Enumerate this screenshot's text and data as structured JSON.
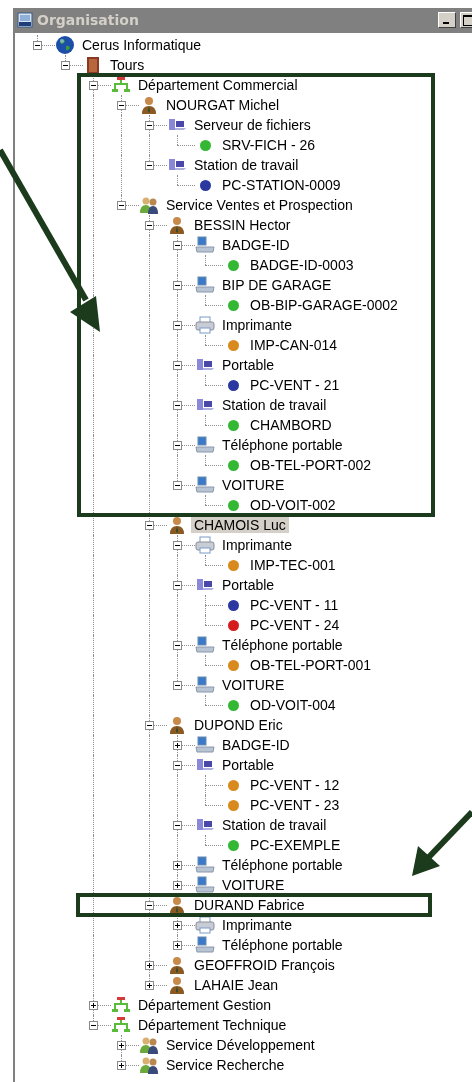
{
  "window": {
    "title": "Organisation"
  },
  "tree": [
    {
      "label": "Cerus Informatique",
      "kind": "organisation",
      "expanded": true,
      "selected": false,
      "children": [
        {
          "label": "Tours",
          "kind": "site",
          "expanded": true,
          "selected": false,
          "children": [
            {
              "label": "Département Commercial",
              "kind": "department",
              "expanded": true,
              "selected": false,
              "children": [
                {
                  "label": "NOURGAT Michel",
                  "kind": "person",
                  "expanded": true,
                  "selected": false,
                  "children": [
                    {
                      "label": "Serveur de fichiers",
                      "kind": "computer",
                      "expanded": true,
                      "selected": false,
                      "children": [
                        {
                          "label": "SRV-FICH - 26",
                          "kind": "device",
                          "color": "#34b834",
                          "selected": false
                        }
                      ]
                    },
                    {
                      "label": "Station de travail",
                      "kind": "computer",
                      "expanded": true,
                      "selected": false,
                      "children": [
                        {
                          "label": "PC-STATION-0009",
                          "kind": "device",
                          "color": "#2a38a0",
                          "selected": false
                        }
                      ]
                    }
                  ]
                },
                {
                  "label": "Service Ventes et Prospection",
                  "kind": "service",
                  "expanded": true,
                  "selected": false,
                  "children": [
                    {
                      "label": "BESSIN Hector",
                      "kind": "person",
                      "expanded": true,
                      "selected": false,
                      "children": [
                        {
                          "label": "BADGE-ID",
                          "kind": "workstation",
                          "expanded": true,
                          "selected": false,
                          "children": [
                            {
                              "label": "BADGE-ID-0003",
                              "kind": "device",
                              "color": "#34b834",
                              "selected": false
                            }
                          ]
                        },
                        {
                          "label": "BIP DE GARAGE",
                          "kind": "workstation",
                          "expanded": true,
                          "selected": false,
                          "children": [
                            {
                              "label": "OB-BIP-GARAGE-0002",
                              "kind": "device",
                              "color": "#34b834",
                              "selected": false
                            }
                          ]
                        },
                        {
                          "label": "Imprimante",
                          "kind": "printer",
                          "expanded": true,
                          "selected": false,
                          "children": [
                            {
                              "label": "IMP-CAN-014",
                              "kind": "device",
                              "color": "#d98a1c",
                              "selected": false
                            }
                          ]
                        },
                        {
                          "label": "Portable",
                          "kind": "computer",
                          "expanded": true,
                          "selected": false,
                          "children": [
                            {
                              "label": "PC-VENT - 21",
                              "kind": "device",
                              "color": "#2a38a0",
                              "selected": false
                            }
                          ]
                        },
                        {
                          "label": "Station de travail",
                          "kind": "computer",
                          "expanded": true,
                          "selected": false,
                          "children": [
                            {
                              "label": "CHAMBORD",
                              "kind": "device",
                              "color": "#34b834",
                              "selected": false
                            }
                          ]
                        },
                        {
                          "label": "Téléphone portable",
                          "kind": "workstation",
                          "expanded": true,
                          "selected": false,
                          "children": [
                            {
                              "label": "OB-TEL-PORT-002",
                              "kind": "device",
                              "color": "#34b834",
                              "selected": false
                            }
                          ]
                        },
                        {
                          "label": "VOITURE",
                          "kind": "workstation",
                          "expanded": true,
                          "selected": false,
                          "children": [
                            {
                              "label": "OD-VOIT-002",
                              "kind": "device",
                              "color": "#34b834",
                              "selected": false
                            }
                          ]
                        }
                      ]
                    },
                    {
                      "label": "CHAMOIS Luc",
                      "kind": "person",
                      "expanded": true,
                      "selected": true,
                      "children": [
                        {
                          "label": "Imprimante",
                          "kind": "printer",
                          "expanded": true,
                          "selected": false,
                          "children": [
                            {
                              "label": "IMP-TEC-001",
                              "kind": "device",
                              "color": "#d98a1c",
                              "selected": false
                            }
                          ]
                        },
                        {
                          "label": "Portable",
                          "kind": "computer",
                          "expanded": true,
                          "selected": false,
                          "children": [
                            {
                              "label": "PC-VENT - 11",
                              "kind": "device",
                              "color": "#2a38a0",
                              "selected": false
                            },
                            {
                              "label": "PC-VENT - 24",
                              "kind": "device",
                              "color": "#d41c1c",
                              "selected": false
                            }
                          ]
                        },
                        {
                          "label": "Téléphone portable",
                          "kind": "workstation",
                          "expanded": true,
                          "selected": false,
                          "children": [
                            {
                              "label": "OB-TEL-PORT-001",
                              "kind": "device",
                              "color": "#d98a1c",
                              "selected": false
                            }
                          ]
                        },
                        {
                          "label": "VOITURE",
                          "kind": "workstation",
                          "expanded": true,
                          "selected": false,
                          "children": [
                            {
                              "label": "OD-VOIT-004",
                              "kind": "device",
                              "color": "#34b834",
                              "selected": false
                            }
                          ]
                        }
                      ]
                    },
                    {
                      "label": "DUPOND Eric",
                      "kind": "person",
                      "expanded": true,
                      "selected": false,
                      "children": [
                        {
                          "label": "BADGE-ID",
                          "kind": "workstation",
                          "expanded": false,
                          "selected": false
                        },
                        {
                          "label": "Portable",
                          "kind": "computer",
                          "expanded": true,
                          "selected": false,
                          "children": [
                            {
                              "label": "PC-VENT - 12",
                              "kind": "device",
                              "color": "#d98a1c",
                              "selected": false
                            },
                            {
                              "label": "PC-VENT - 23",
                              "kind": "device",
                              "color": "#d98a1c",
                              "selected": false
                            }
                          ]
                        },
                        {
                          "label": "Station de travail",
                          "kind": "computer",
                          "expanded": true,
                          "selected": false,
                          "children": [
                            {
                              "label": "PC-EXEMPLE",
                              "kind": "device",
                              "color": "#34b834",
                              "selected": false
                            }
                          ]
                        },
                        {
                          "label": "Téléphone portable",
                          "kind": "workstation",
                          "expanded": false,
                          "selected": false
                        },
                        {
                          "label": "VOITURE",
                          "kind": "workstation",
                          "expanded": false,
                          "selected": false
                        }
                      ]
                    },
                    {
                      "label": "DURAND Fabrice",
                      "kind": "person",
                      "expanded": true,
                      "selected": false,
                      "children": [
                        {
                          "label": "Imprimante",
                          "kind": "printer",
                          "expanded": false,
                          "selected": false
                        },
                        {
                          "label": "Téléphone portable",
                          "kind": "workstation",
                          "expanded": false,
                          "selected": false
                        }
                      ]
                    },
                    {
                      "label": "GEOFFROID François",
                      "kind": "person",
                      "expanded": false,
                      "selected": false
                    },
                    {
                      "label": "LAHAIE Jean",
                      "kind": "person",
                      "expanded": false,
                      "selected": false
                    }
                  ]
                }
              ]
            },
            {
              "label": "Département Gestion",
              "kind": "department",
              "expanded": false,
              "selected": false
            },
            {
              "label": "Département Technique",
              "kind": "department",
              "expanded": true,
              "selected": false,
              "children": [
                {
                  "label": "Service Développement",
                  "kind": "service",
                  "expanded": false,
                  "selected": false
                },
                {
                  "label": "Service Recherche",
                  "kind": "service",
                  "expanded": false,
                  "selected": false
                }
              ]
            }
          ]
        }
      ]
    }
  ]
}
